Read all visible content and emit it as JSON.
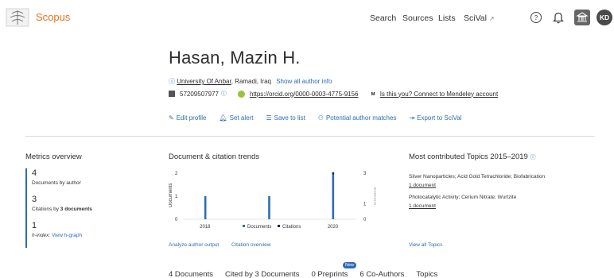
{
  "header": {
    "brand": "Scopus",
    "nav": [
      "Search",
      "Sources",
      "Lists",
      "SciVal"
    ],
    "scival_ext": "↗",
    "help_icon": "question-icon",
    "bell_icon": "bell-icon",
    "institution_icon": "institution-icon",
    "avatar_initials": "KD"
  },
  "profile": {
    "name": "Hasan, Mazin H.",
    "affiliation": "University Of Anbar",
    "location": ", Ramadi, Iraq",
    "show_author_info": "Show all author info",
    "author_id": "57209507977",
    "orcid": "https://orcid.org/0000-0003-4775-9156",
    "mendeley": "Is this you? Connect to Mendeley account",
    "actions": [
      "Edit profile",
      "Set alert",
      "Save to list",
      "Potential author matches",
      "Export to SciVal"
    ]
  },
  "metrics": {
    "title": "Metrics overview",
    "documents_value": "4",
    "documents_label": "Documents by author",
    "citations_value": "3",
    "citations_label_prefix": "Citations by ",
    "citations_label_bold": "3 documents",
    "hindex_value": "1",
    "hindex_label": "h-index:",
    "hindex_link": "View h-graph"
  },
  "trends": {
    "title": "Document & citation trends",
    "analyze_link": "Analyze author output",
    "citation_link": "Citation overview"
  },
  "chart_data": {
    "type": "bar",
    "categories": [
      "2018",
      "2019",
      "2020"
    ],
    "x_ticks_shown": [
      "2018",
      "2020"
    ],
    "series": [
      {
        "name": "Documents",
        "values": [
          1,
          1,
          2
        ],
        "color": "#2e6bb8"
      },
      {
        "name": "Citations",
        "values": [
          0,
          0,
          3
        ],
        "color": "#1a2850"
      }
    ],
    "ylabel": "Documents",
    "y2label": "Citations",
    "ylim": [
      0,
      2
    ],
    "y2lim": [
      0,
      3
    ],
    "y_ticks": [
      "2",
      "1",
      "0"
    ],
    "y2_ticks": [
      "3",
      "1",
      "0"
    ],
    "legend": "bottom"
  },
  "topics": {
    "title": "Most contributed Topics 2015–2019",
    "items": [
      {
        "name": "Silver Nanoparticles; Acid Gold Tetrachloride; Biofabrication",
        "count": "1 document"
      },
      {
        "name": "Photocatalytic Activity; Cerium Nitrate; Wurtzite",
        "count": "1 document"
      }
    ],
    "view_all": "View all Topics"
  },
  "tabs": {
    "items": [
      "4 Documents",
      "Cited by 3 Documents",
      "0 Preprints",
      "6 Co-Authors",
      "Topics"
    ],
    "new_badge": "New"
  },
  "colors": {
    "brand": "#e9711c",
    "link": "#2e6bb8",
    "citations": "#1a2850"
  }
}
